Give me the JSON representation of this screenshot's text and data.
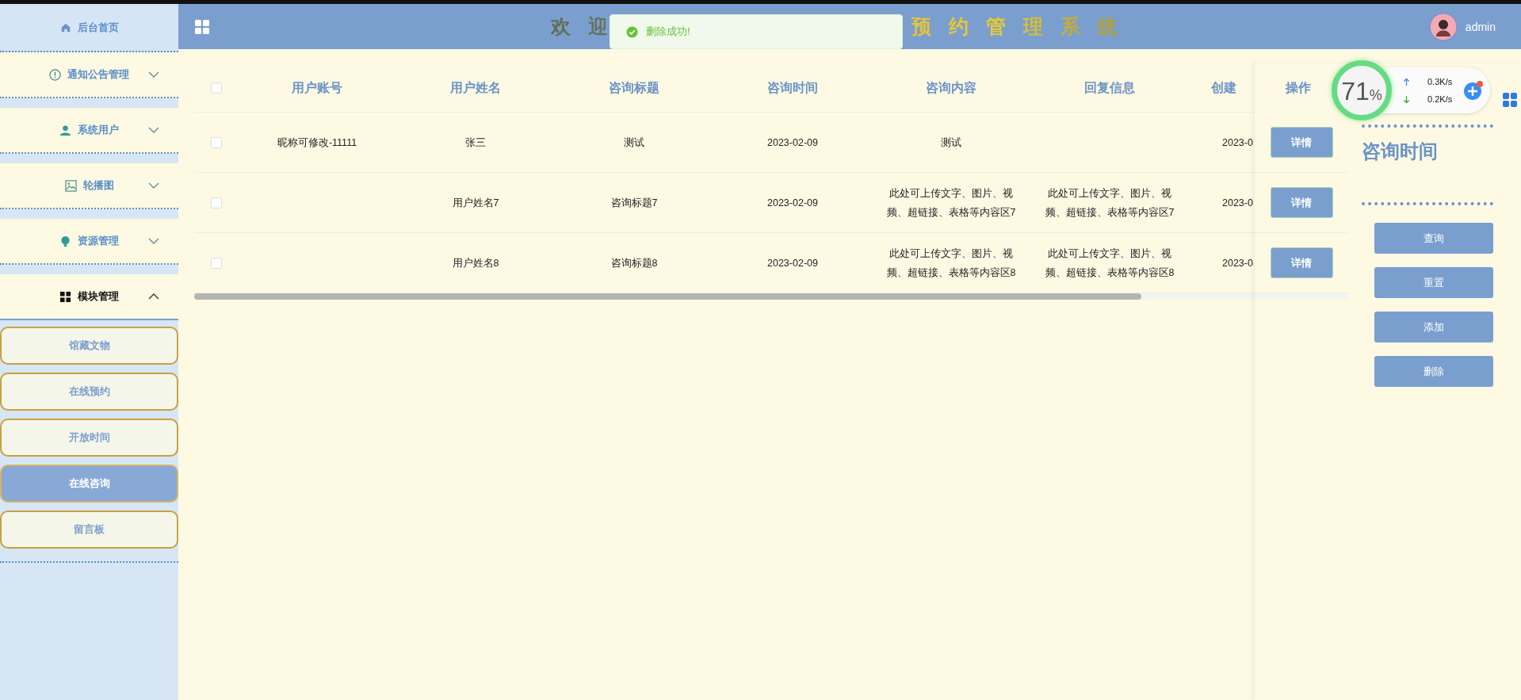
{
  "sidebar": {
    "items": [
      {
        "kind": "link",
        "label": "后台首页"
      },
      {
        "kind": "group",
        "label": "通知公告管理",
        "expanded": false
      },
      {
        "kind": "group",
        "label": "系统用户",
        "expanded": false
      },
      {
        "kind": "group",
        "label": "轮播图",
        "expanded": false
      },
      {
        "kind": "group",
        "label": "资源管理",
        "expanded": false
      },
      {
        "kind": "group",
        "label": "模块管理",
        "expanded": true,
        "children": [
          {
            "label": "馆藏文物",
            "selected": false
          },
          {
            "label": "在线预约",
            "selected": false
          },
          {
            "label": "开放时间",
            "selected": false
          },
          {
            "label": "在线咨询",
            "selected": true
          },
          {
            "label": "留言板",
            "selected": false
          }
        ]
      }
    ]
  },
  "header": {
    "title_parts": [
      "欢迎",
      "预约管理系统"
    ],
    "user": "admin"
  },
  "toast": {
    "kind": "success",
    "text": "删除成功!"
  },
  "table": {
    "select_all_checked": false,
    "columns": [
      "用户账号",
      "用户姓名",
      "咨询标题",
      "咨询时间",
      "咨询内容",
      "回复信息",
      "创建"
    ],
    "action_column": "操作",
    "rows": [
      {
        "checked": false,
        "cells": [
          "昵称可修改-11111",
          "张三",
          "测试",
          "2023-02-09",
          "测试",
          null,
          "2023-0"
        ],
        "action": "详情"
      },
      {
        "checked": false,
        "cells": [
          null,
          "用户姓名7",
          "咨询标题7",
          "2023-02-09",
          "此处可上传文字、图片、视频、超链接、表格等内容区7",
          "此处可上传文字、图片、视频、超链接、表格等内容区7",
          "2023-0"
        ],
        "action": "详情"
      },
      {
        "checked": false,
        "cells": [
          null,
          "用户姓名8",
          "咨询标题8",
          "2023-02-09",
          "此处可上传文字、图片、视频、超链接、表格等内容区8",
          "此处可上传文字、图片、视频、超链接、表格等内容区8",
          "2023-0"
        ],
        "action": "详情"
      }
    ]
  },
  "search_panel": {
    "label": "咨询时间",
    "buttons": [
      "查询",
      "重置",
      "添加",
      "删除"
    ]
  },
  "speed_widget": {
    "percent": "71",
    "unit": "%",
    "upload": "0.3K/s",
    "download": "0.2K/s"
  }
}
